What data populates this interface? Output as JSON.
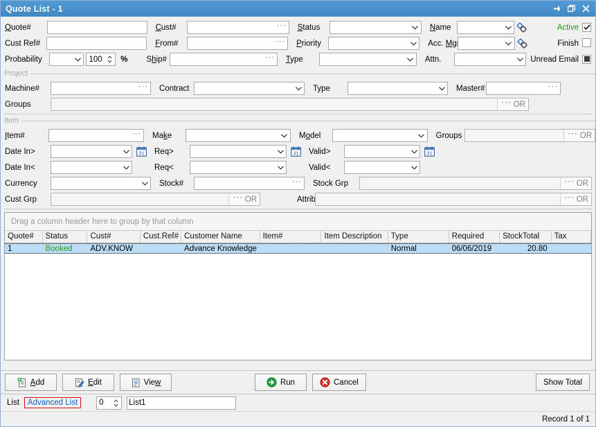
{
  "window": {
    "title": "Quote List - 1",
    "controls": [
      {
        "name": "pin-icon",
        "label": "Pin"
      },
      {
        "name": "restore-icon",
        "label": "Restore"
      },
      {
        "name": "close-icon",
        "label": "Close"
      }
    ]
  },
  "filters": {
    "quote_no": {
      "label": "Quote#",
      "accel": "Q",
      "value": ""
    },
    "cust_ref_no": {
      "label": "Cust Ref#",
      "accel": "",
      "value": ""
    },
    "probability": {
      "label": "Probability",
      "combo_value": "",
      "spin_value": "100",
      "unit": "%"
    },
    "cust_no": {
      "label": "Cust#",
      "accel": "C",
      "value": ""
    },
    "from_no": {
      "label": "From#",
      "accel": "F",
      "value": ""
    },
    "ship_no": {
      "label": "Ship#",
      "accel": "h",
      "value": ""
    },
    "status": {
      "label": "Status",
      "accel": "S",
      "value": ""
    },
    "priority": {
      "label": "Priority",
      "accel": "P",
      "value": ""
    },
    "type": {
      "label": "Type",
      "accel": "T",
      "value": ""
    },
    "name": {
      "label": "Name",
      "accel": "N",
      "value": ""
    },
    "acc_mgr": {
      "label": "Acc. Mgr",
      "accel": "M",
      "value": ""
    },
    "attn": {
      "label": "Attn.",
      "value": ""
    },
    "active": {
      "label": "Active",
      "checked": true
    },
    "finish": {
      "label": "Finish",
      "checked": false
    },
    "unread_email": {
      "label": "Unread Email",
      "state": "indeterminate"
    }
  },
  "project": {
    "caption": "Project",
    "machine_no": {
      "label": "Machine#",
      "value": ""
    },
    "contract": {
      "label": "Contract",
      "value": ""
    },
    "type": {
      "label": "Type",
      "value": ""
    },
    "master_no": {
      "label": "Master#",
      "value": ""
    },
    "groups": {
      "label": "Groups",
      "value": "",
      "or_label": "OR"
    }
  },
  "item": {
    "caption": "Item",
    "item_no": {
      "label": "Item#",
      "accel": "I",
      "value": ""
    },
    "make": {
      "label": "Make",
      "accel": "k",
      "value": ""
    },
    "model": {
      "label": "Model",
      "accel": "o",
      "value": ""
    },
    "groups": {
      "label": "Groups",
      "value": "",
      "or_label": "OR"
    },
    "date_in_gt": {
      "label": "Date In>",
      "value": ""
    },
    "req_gt": {
      "label": "Req>",
      "value": ""
    },
    "valid_gt": {
      "label": "Valid>",
      "value": ""
    },
    "date_in_lt": {
      "label": "Date In<",
      "value": ""
    },
    "req_lt": {
      "label": "Req<",
      "value": ""
    },
    "valid_lt": {
      "label": "Valid<",
      "value": ""
    },
    "currency": {
      "label": "Currency",
      "value": ""
    },
    "stock_no": {
      "label": "Stock#",
      "value": ""
    },
    "stock_grp": {
      "label": "Stock Grp",
      "value": "",
      "or_label": "OR"
    },
    "cust_grp": {
      "label": "Cust Grp",
      "value": "",
      "or_label": "OR"
    },
    "attributes": {
      "label": "Attributes",
      "value": "",
      "or_label": "OR"
    }
  },
  "grid": {
    "group_hint": "Drag a column header here to group by that column",
    "columns": [
      {
        "key": "quote_no",
        "label": "Quote#",
        "width": 57,
        "align": "left"
      },
      {
        "key": "status",
        "label": "Status",
        "width": 68,
        "align": "left"
      },
      {
        "key": "cust_no",
        "label": "Cust#",
        "width": 80,
        "align": "left"
      },
      {
        "key": "cust_ref_no",
        "label": "Cust.Ref#",
        "width": 62,
        "align": "left"
      },
      {
        "key": "customer_name",
        "label": "Customer Name",
        "width": 119,
        "align": "left"
      },
      {
        "key": "item_no",
        "label": "Item#",
        "width": 93,
        "align": "left"
      },
      {
        "key": "item_description",
        "label": "Item Description",
        "width": 101,
        "align": "left"
      },
      {
        "key": "type",
        "label": "Type",
        "width": 92,
        "align": "left"
      },
      {
        "key": "required",
        "label": "Required",
        "width": 77,
        "align": "left"
      },
      {
        "key": "stocktotal",
        "label": "StockTotal",
        "width": 78,
        "align": "right"
      },
      {
        "key": "tax",
        "label": "Tax",
        "width": 60,
        "align": "left"
      }
    ],
    "rows": [
      {
        "quote_no": "1",
        "status": "Booked",
        "cust_no": "ADV.KNOW",
        "cust_ref_no": "",
        "customer_name": "Advance Knowledge",
        "item_no": "",
        "item_description": "",
        "type": "Normal",
        "required": "06/06/2019",
        "stocktotal": "20.80",
        "tax": ""
      }
    ],
    "status_color": "#1d9a1d",
    "row_selected_color": "#bcddf5"
  },
  "buttons": {
    "add": {
      "label": "Add",
      "accel": "A",
      "icon": "add-document-icon"
    },
    "edit": {
      "label": "Edit",
      "accel": "E",
      "icon": "edit-pencil-icon"
    },
    "view": {
      "label": "View",
      "accel": "w",
      "icon": "document-icon"
    },
    "run": {
      "label": "Run",
      "icon": "run-arrow-icon"
    },
    "cancel": {
      "label": "Cancel",
      "icon": "cancel-x-icon"
    },
    "show_total": {
      "label": "Show Total"
    }
  },
  "bottom": {
    "list_label": "List",
    "advanced_list_label": "Advanced List",
    "index_value": "0",
    "list_name": "List1",
    "record_status": "Record 1 of 1"
  }
}
